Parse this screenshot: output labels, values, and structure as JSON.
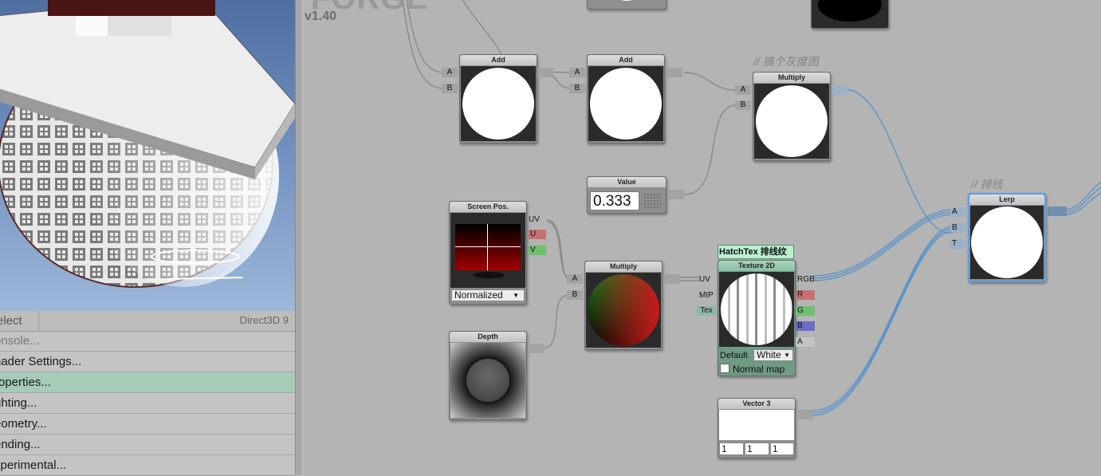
{
  "app": {
    "version": "v1.40",
    "logo_text": "FORGE"
  },
  "menu": {
    "select_label": "elect",
    "graphics_api": "Direct3D 9",
    "items": [
      {
        "label": "onsole...",
        "state": "disabled"
      },
      {
        "label": "hader Settings...",
        "state": "normal"
      },
      {
        "label": "roperties...",
        "state": "active"
      },
      {
        "label": "ghting...",
        "state": "normal"
      },
      {
        "label": "eometry...",
        "state": "normal"
      },
      {
        "label": "ending...",
        "state": "normal"
      },
      {
        "label": "xperimental...",
        "state": "normal"
      }
    ]
  },
  "comments": {
    "gray": "// 搞个灰度图",
    "hatch": "// 排线"
  },
  "nodes": {
    "add1": {
      "title": "Add",
      "in_a": "A",
      "in_b": "B"
    },
    "add2": {
      "title": "Add",
      "in_a": "A",
      "in_b": "B"
    },
    "multiply1": {
      "title": "Multiply",
      "in_a": "A",
      "in_b": "B"
    },
    "value": {
      "title": "Value",
      "value": "0.333"
    },
    "screenpos": {
      "title": "Screen Pos.",
      "out_uv": "UV",
      "out_u": "U",
      "out_v": "V",
      "mode": "Normalized"
    },
    "multiply2": {
      "title": "Multiply",
      "in_a": "A",
      "in_b": "B"
    },
    "depth": {
      "title": "Depth"
    },
    "texture": {
      "name": "HatchTex 排线纹理",
      "title": "Texture 2D",
      "in_uv": "UV",
      "in_mip": "MIP",
      "in_tex": "Tex",
      "out_rgb": "RGB",
      "out_r": "R",
      "out_g": "G",
      "out_b": "B",
      "out_a": "A",
      "default_label": "Default",
      "default_value": "White",
      "normal_map_label": "Normal map",
      "normal_map": false
    },
    "vector3": {
      "title": "Vector 3",
      "x": "1",
      "y": "1",
      "z": "1"
    },
    "lerp": {
      "title": "Lerp",
      "in_a": "A",
      "in_b": "B",
      "in_t": "T"
    }
  },
  "colors": {
    "r_port": "#c77070",
    "g_port": "#6fbf6f",
    "b_port": "#6b6bc7",
    "selection": "#5aa0e6",
    "wire_selected": "#5b94c8",
    "wire": "#8a8a8a"
  }
}
